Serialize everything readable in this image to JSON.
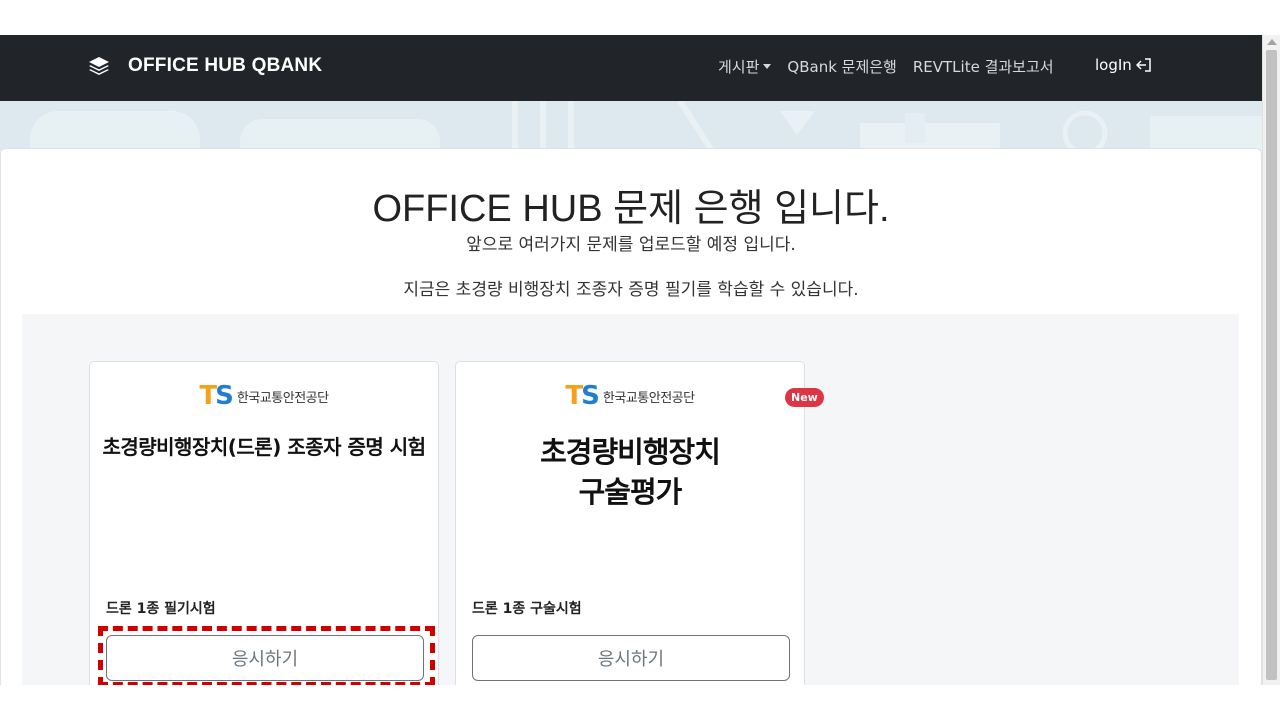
{
  "nav": {
    "brand": "OFFICE HUB QBANK",
    "links": [
      "게시판",
      "QBank 문제은행",
      "REVTLite 결과보고서"
    ],
    "login": "logIn"
  },
  "hero": {
    "title": "OFFICE HUB 문제 은행 입니다.",
    "line1": "앞으로 여러가지 문제를 업로드할 예정 입니다.",
    "line2": "지금은 초경량 비행장치 조종자 증명 필기를 학습할 수 있습니다."
  },
  "cards": [
    {
      "logo_org": "한국교통안전공단",
      "title": "초경량비행장치(드론) 조종자 증명 시험",
      "label": "드론 1종 필기시험",
      "button": "응시하기"
    },
    {
      "logo_org": "한국교통안전공단",
      "title_line1": "초경량비행장치",
      "title_line2": "구술평가",
      "label": "드론 1종 구술시험",
      "button": "응시하기",
      "badge": "New"
    }
  ],
  "logo_letters": {
    "t": "T",
    "s": "S"
  },
  "colors": {
    "navbar": "#212529",
    "badge": "#dc3545",
    "logo_t": "#f4a11c",
    "logo_s": "#1f7fce",
    "highlight": "#d10000"
  },
  "icons": {
    "brand": "layers-icon",
    "login": "sign-in-icon"
  }
}
